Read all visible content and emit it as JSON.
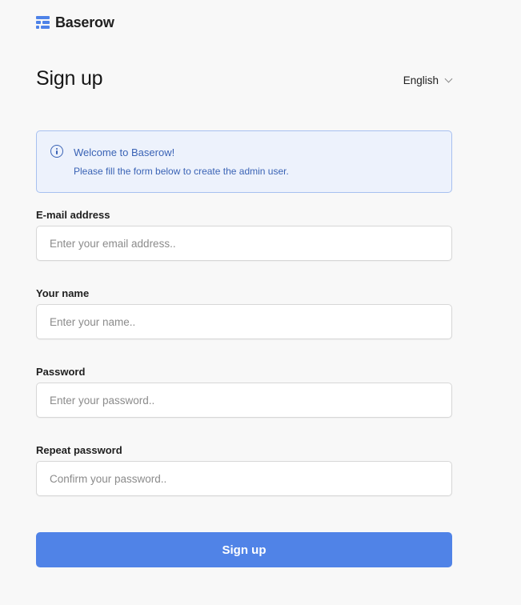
{
  "brand": {
    "name": "Baserow",
    "accent_color": "#4e82e8"
  },
  "header": {
    "title": "Sign up",
    "language": {
      "selected": "English",
      "icon": "chevron-down-icon"
    }
  },
  "alert": {
    "icon": "info-icon",
    "title": "Welcome to Baserow!",
    "message": "Please fill the form below to create the admin user.",
    "color": "#3a63b5",
    "background": "#edf2fc"
  },
  "form": {
    "email": {
      "label": "E-mail address",
      "value": "",
      "placeholder": "Enter your email address.."
    },
    "name": {
      "label": "Your name",
      "value": "",
      "placeholder": "Enter your name.."
    },
    "password": {
      "label": "Password",
      "value": "",
      "placeholder": "Enter your password.."
    },
    "repeat_password": {
      "label": "Repeat password",
      "value": "",
      "placeholder": "Confirm your password.."
    },
    "submit_label": "Sign up",
    "submit_color": "#5083e7"
  }
}
